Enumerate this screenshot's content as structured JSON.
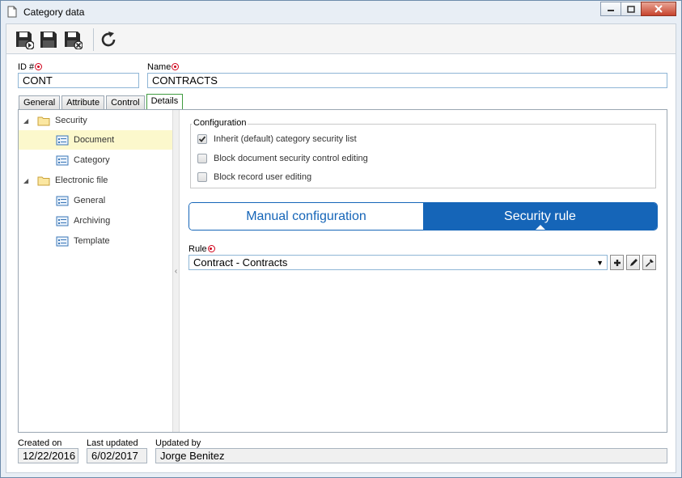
{
  "window": {
    "title": "Category data"
  },
  "toolbar": {
    "buttons": [
      {
        "icon": "save-new-icon"
      },
      {
        "icon": "save-icon"
      },
      {
        "icon": "save-close-icon"
      },
      {
        "icon": "refresh-icon"
      }
    ]
  },
  "header": {
    "id_label": "ID #",
    "id_value": "CONT",
    "name_label": "Name",
    "name_value": "CONTRACTS"
  },
  "tabs": [
    {
      "label": "General"
    },
    {
      "label": "Attribute"
    },
    {
      "label": "Control"
    },
    {
      "label": "Details"
    }
  ],
  "tree": [
    {
      "label": "Security",
      "level": 0,
      "type": "folder"
    },
    {
      "label": "Document",
      "level": 1,
      "type": "page",
      "selected": true
    },
    {
      "label": "Category",
      "level": 1,
      "type": "page"
    },
    {
      "label": "Electronic file",
      "level": 0,
      "type": "folder"
    },
    {
      "label": "General",
      "level": 1,
      "type": "page"
    },
    {
      "label": "Archiving",
      "level": 1,
      "type": "page"
    },
    {
      "label": "Template",
      "level": 1,
      "type": "page"
    }
  ],
  "configuration": {
    "legend": "Configuration",
    "options": [
      {
        "label": "Inherit (default) category security list",
        "checked": true
      },
      {
        "label": "Block document security control editing",
        "checked": false
      },
      {
        "label": "Block record user editing",
        "checked": false
      }
    ]
  },
  "segmented": {
    "options": [
      "Manual configuration",
      "Security rule"
    ],
    "active": 1
  },
  "rule": {
    "label": "Rule",
    "value": "Contract - Contracts"
  },
  "footer": {
    "created_label": "Created on",
    "created_value": "12/22/2016",
    "updated_label": "Last updated",
    "updated_value": "6/02/2017",
    "updated_by_label": "Updated by",
    "updated_by_value": "Jorge Benitez"
  },
  "colors": {
    "accent": "#1565b8",
    "required": "#d0021b",
    "selected_row": "#fcf8cc"
  }
}
